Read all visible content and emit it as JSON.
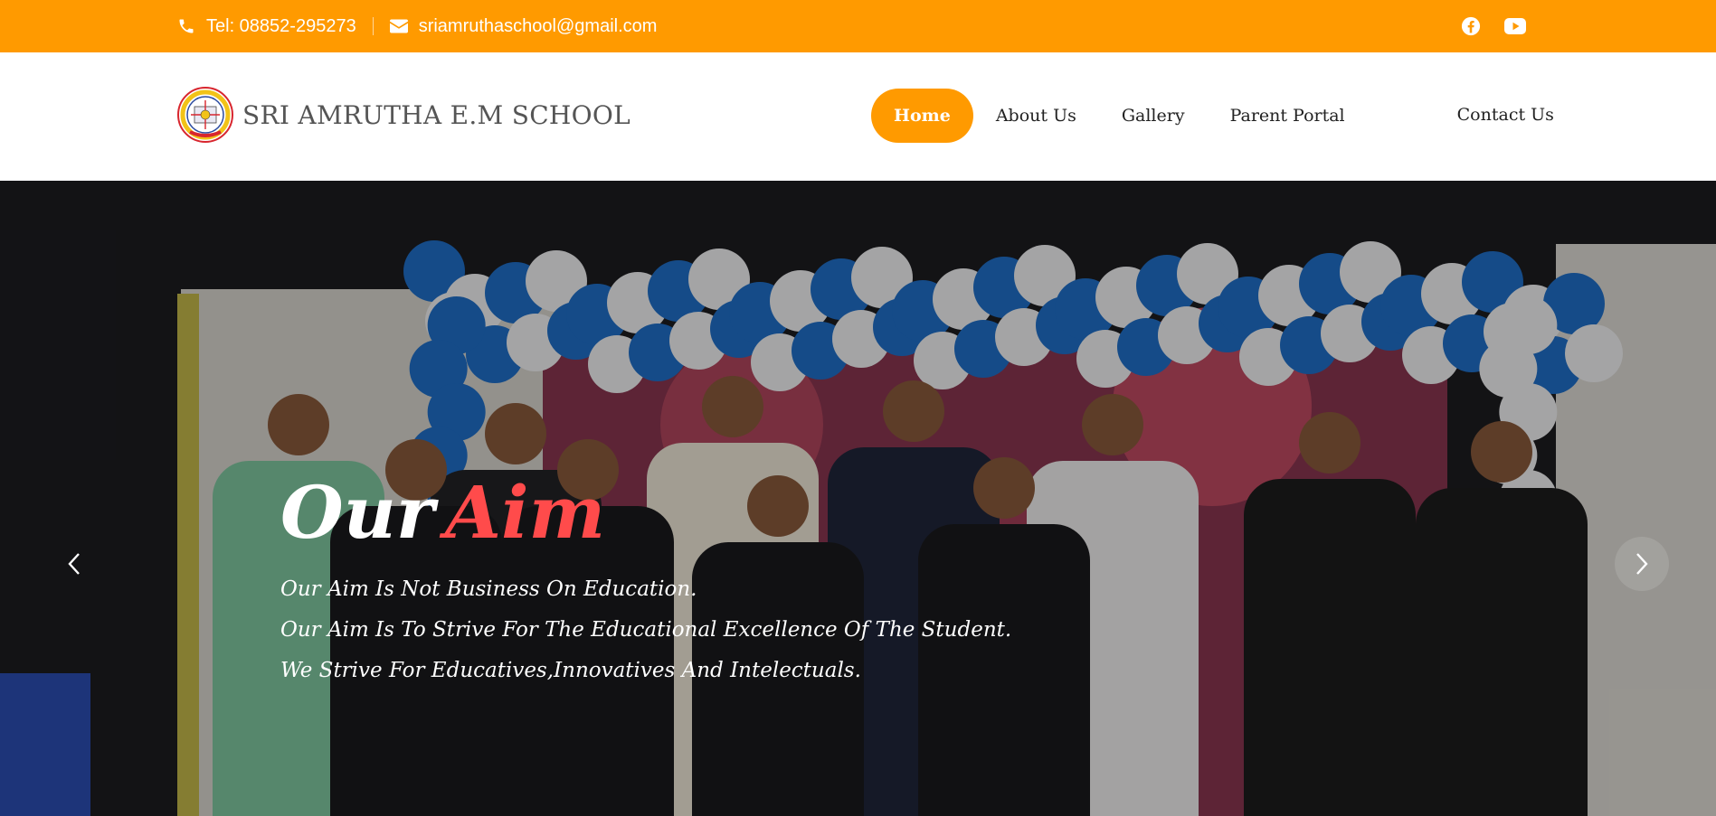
{
  "topbar": {
    "phone": "Tel: 08852-295273",
    "email": "sriamruthaschool@gmail.com",
    "social_icons": [
      "facebook-icon",
      "youtube-icon"
    ]
  },
  "header": {
    "brand_name": "SRI AMRUTHA E.M SCHOOL",
    "nav": [
      {
        "label": "Home",
        "active": true
      },
      {
        "label": "About Us"
      },
      {
        "label": "Gallery"
      },
      {
        "label": "Parent Portal"
      },
      {
        "label": "Contact Us"
      }
    ]
  },
  "hero": {
    "title_main": "Our",
    "title_accent": "Aim",
    "lines": [
      "Our Aim Is Not Business On Education.",
      "Our Aim Is To Strive For The Educational Excellence Of The Student.",
      "We Strive For Educatives,Innovatives And Intelectuals."
    ],
    "controls": [
      "chevron-left-icon",
      "chevron-right-icon"
    ]
  },
  "colors": {
    "accent": "#ff9a00",
    "title_accent": "#ff4b4b",
    "balloon_blue": "#1f6fc9",
    "balloon_white": "#f2f2f4"
  }
}
